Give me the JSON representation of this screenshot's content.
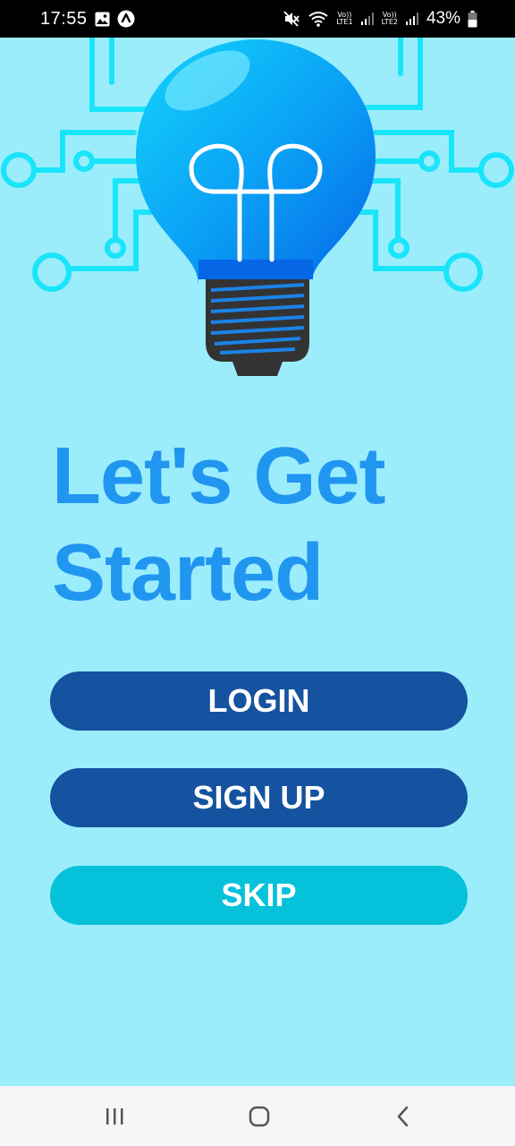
{
  "status_bar": {
    "time": "17:55",
    "sim1_label_top": "Vo))",
    "sim1_label_bottom": "LTE1",
    "sim2_label_top": "Vo))",
    "sim2_label_bottom": "LTE2",
    "battery_percent": "43%",
    "icons": [
      "gallery-icon",
      "app-notification-icon",
      "mute-icon",
      "wifi-icon",
      "signal-icon",
      "battery-icon"
    ]
  },
  "hero": {
    "illustration": "lightbulb-circuit-icon"
  },
  "headline": {
    "line1": "Let's Get",
    "line2": "Started"
  },
  "buttons": {
    "login": "LOGIN",
    "signup": "SIGN UP",
    "skip": "SKIP"
  },
  "nav_bar": {
    "icons": [
      "recent-apps-icon",
      "home-icon",
      "back-icon"
    ]
  },
  "colors": {
    "background": "#9bedfc",
    "headline": "#2196f0",
    "primary_button": "#1552a0",
    "secondary_button": "#06c1da",
    "bulb": "#0aa8f5",
    "circuit": "#19e4fa"
  }
}
